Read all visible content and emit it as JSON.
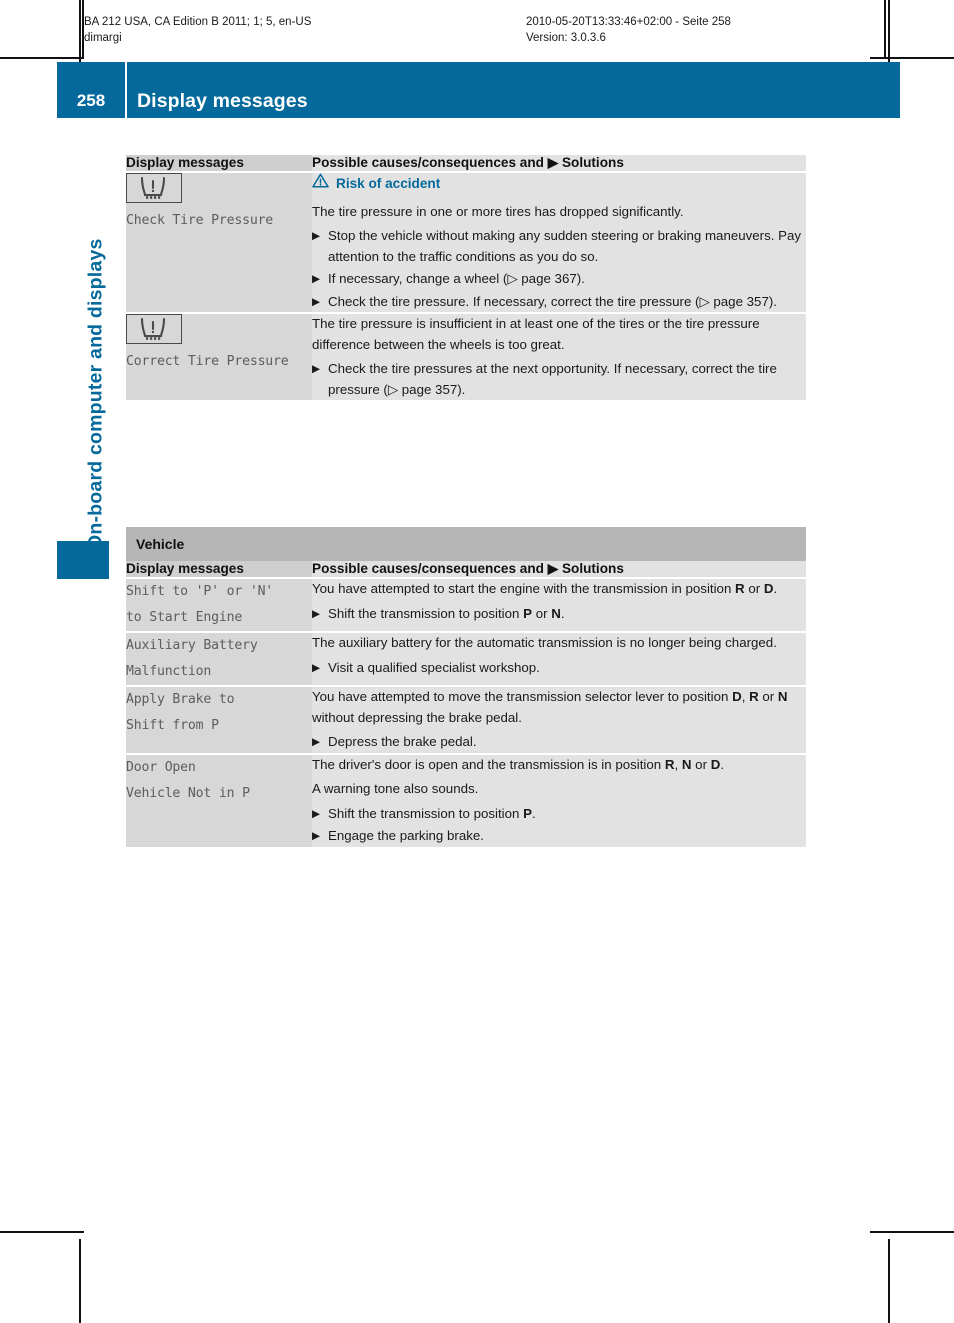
{
  "print_header": {
    "line1": "BA 212 USA, CA Edition B 2011; 1; 5, en-US",
    "line2": "dimargi",
    "right_line1": "2010-05-20T13:33:46+02:00 - Seite 258",
    "right_line2": "Version: 3.0.3.6"
  },
  "header": {
    "page_number": "258",
    "title": "Display messages",
    "accent_color": "#056a9b"
  },
  "chapter_tab": {
    "label": "On-board computer and displays"
  },
  "table1": {
    "columns": {
      "col1": "Display messages",
      "col2": "Possible causes/consequences and ▶ Solutions"
    },
    "rows": [
      {
        "icon": "tire-pressure-warning-icon",
        "message": "Check Tire Pressure",
        "warning_title": "Risk of accident",
        "warning_color": "#056a9b",
        "paragraphs": [
          "The tire pressure in one or more tires has dropped significantly."
        ],
        "steps": [
          "Stop the vehicle without making any sudden steering or braking maneuvers. Pay attention to the traffic conditions as you do so.",
          "If necessary, change a wheel (▷ page 367).",
          "Check the tire pressure. If necessary, correct the tire pressure (▷ page 357)."
        ]
      },
      {
        "icon": "tire-pressure-warning-icon",
        "message": "Correct Tire Pressure",
        "paragraphs": [
          "The tire pressure is insufficient in at least one of the tires or the tire pressure difference between the wheels is too great."
        ],
        "steps": [
          "Check the tire pressures at the next opportunity. If necessary, correct the tire pressure (▷ page 357)."
        ]
      }
    ]
  },
  "section_vehicle": {
    "title": "Vehicle"
  },
  "table2": {
    "columns": {
      "col1": "Display messages",
      "col2": "Possible causes/consequences and ▶ Solutions"
    },
    "rows": [
      {
        "message": "Shift to 'P' or 'N'\nto Start Engine",
        "paragraph_html": "You have attempted to start the engine with the transmission in position <b>R</b> or <b>D</b>.",
        "steps_html": [
          "Shift the transmission to position <b>P</b> or <b>N</b>."
        ]
      },
      {
        "message": "Auxiliary Battery\nMalfunction",
        "paragraph_html": "The auxiliary battery for the automatic transmission is no longer being charged.",
        "steps_html": [
          "Visit a qualified specialist workshop."
        ]
      },
      {
        "message": "Apply Brake to\nShift from P",
        "paragraph_html": "You have attempted to move the transmission selector lever to position <b>D</b>, <b>R</b> or <b>N</b> without depressing the brake pedal.",
        "steps_html": [
          "Depress the brake pedal."
        ]
      },
      {
        "message": "Door Open\nVehicle Not in P",
        "paragraph_html": "The driver's door is open and the transmission is in position <b>R</b>, <b>N</b> or <b>D</b>.",
        "paragraph2_html": "A warning tone also sounds.",
        "steps_html": [
          "Shift the transmission to position <b>P</b>.",
          "Engage the parking brake."
        ]
      }
    ]
  }
}
